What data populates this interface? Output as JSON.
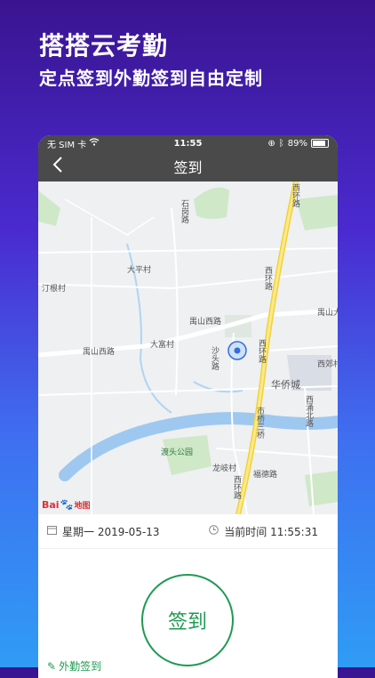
{
  "promo": {
    "title": "搭搭云考勤",
    "subtitle": "定点签到外勤签到自由定制"
  },
  "status_bar": {
    "carrier": "无 SIM 卡",
    "time": "11:55",
    "battery": "89%"
  },
  "nav": {
    "title": "签到"
  },
  "map": {
    "labels": {
      "daping": "大平村",
      "dingen": "汀根村",
      "yushan_rd1": "禺山西路",
      "yushan_rd2": "禺山西路",
      "yushan_rd3": "禺山大",
      "dafu": "大富村",
      "xihuan1": "西环路",
      "xihuan2": "西环路",
      "xihuan3": "西环路",
      "xihuan4": "西环路",
      "huaqiao": "华侨城",
      "xijiao": "西郊村",
      "shiqiao": "市桥三桥",
      "xiyong": "西涌北路",
      "dutou": "渡头公园",
      "longqi": "龙岐村",
      "fude": "福德路",
      "shajiao": "沙头路",
      "sanhe": "石岗路"
    },
    "baidu_logo": "Bai",
    "baidu_logo2": "地图"
  },
  "info": {
    "date": "星期一  2019-05-13",
    "current_time": "当前时间  11:55:31"
  },
  "actions": {
    "sign_in": "签到",
    "outdoor_sign": "外勤签到"
  }
}
